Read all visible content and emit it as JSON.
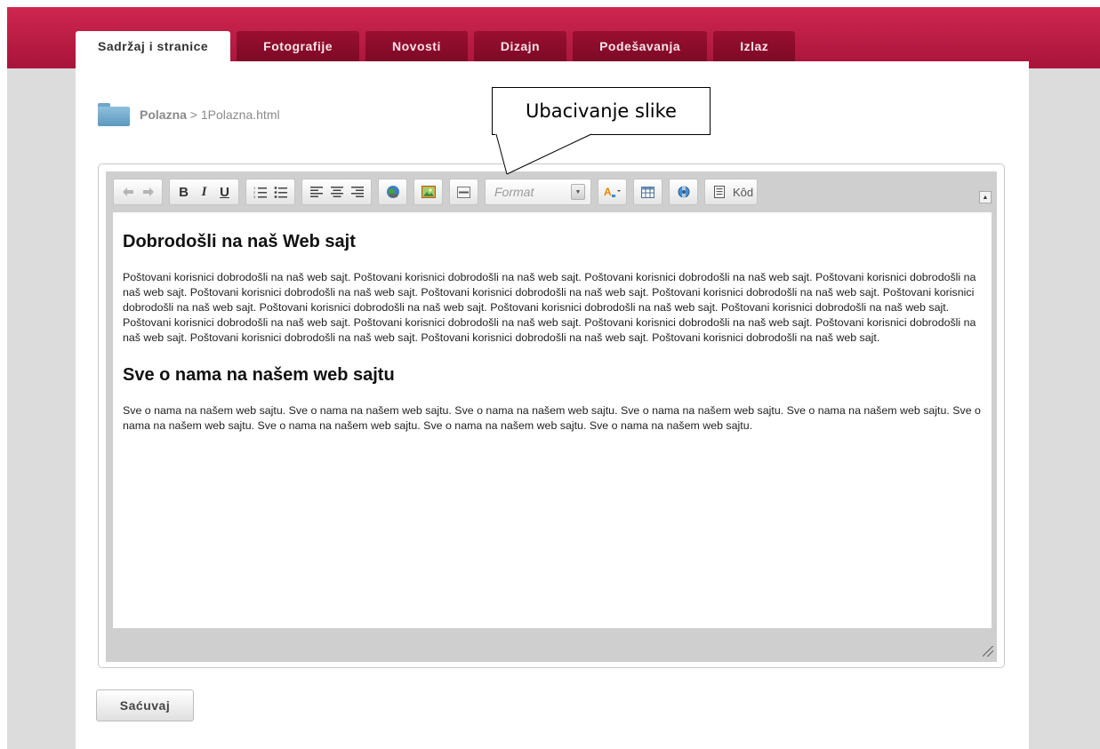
{
  "tabs": [
    {
      "label": "Sadržaj i stranice",
      "active": true
    },
    {
      "label": "Fotografije"
    },
    {
      "label": "Novosti"
    },
    {
      "label": "Dizajn"
    },
    {
      "label": "Podešavanja"
    },
    {
      "label": "Izlaz"
    }
  ],
  "breadcrumb": {
    "root": "Polazna",
    "separator": " > ",
    "page": "1Polazna.html"
  },
  "callout": "Ubacivanje slike",
  "toolbar": {
    "format_placeholder": "Format",
    "code_label": "Kôd",
    "bold": "B",
    "italic": "I",
    "underline": "U"
  },
  "document": {
    "heading1": "Dobrodošli na naš Web sajt",
    "paragraph1": "Poštovani korisnici dobrodošli na naš web sajt. Poštovani korisnici dobrodošli na naš web sajt. Poštovani korisnici dobrodošli na naš web sajt. Poštovani korisnici dobrodošli na naš web sajt. Poštovani korisnici dobrodošli na naš web sajt. Poštovani korisnici dobrodošli na naš web sajt. Poštovani korisnici dobrodošli na naš web sajt. Poštovani korisnici dobrodošli na naš web sajt. Poštovani korisnici dobrodošli na naš web sajt. Poštovani korisnici dobrodošli na naš web sajt. Poštovani korisnici dobrodošli na naš web sajt. Poštovani korisnici dobrodošli na naš web sajt. Poštovani korisnici dobrodošli na naš web sajt. Poštovani korisnici dobrodošli na naš web sajt. Poštovani korisnici dobrodošli na naš web sajt. Poštovani korisnici dobrodošli na naš web sajt. Poštovani korisnici dobrodošli na naš web sajt. Poštovani korisnici dobrodošli na naš web sajt.",
    "heading2": "Sve o nama na našem web sajtu",
    "paragraph2": "Sve o nama na našem web sajtu. Sve o nama na našem web sajtu. Sve o nama na našem web sajtu. Sve o nama na našem web sajtu. Sve o nama na našem web sajtu. Sve o nama na našem web sajtu. Sve o nama na našem web sajtu. Sve o nama na našem web sajtu. Sve o nama na našem web sajtu."
  },
  "save_label": "Saćuvaj",
  "colors": {
    "brand": "#b8173f",
    "tab_inactive": "#8a0c2c",
    "page_bg": "#dcdcdc"
  },
  "icons": [
    "folder-icon",
    "undo-icon",
    "redo-icon",
    "ordered-list-icon",
    "bullet-list-icon",
    "align-left-icon",
    "align-center-icon",
    "align-right-icon",
    "link-globe-icon",
    "insert-image-icon",
    "horizontal-rule-icon",
    "font-color-icon",
    "table-icon",
    "media-icon",
    "source-code-icon",
    "collapse-icon",
    "resize-grip-icon"
  ]
}
